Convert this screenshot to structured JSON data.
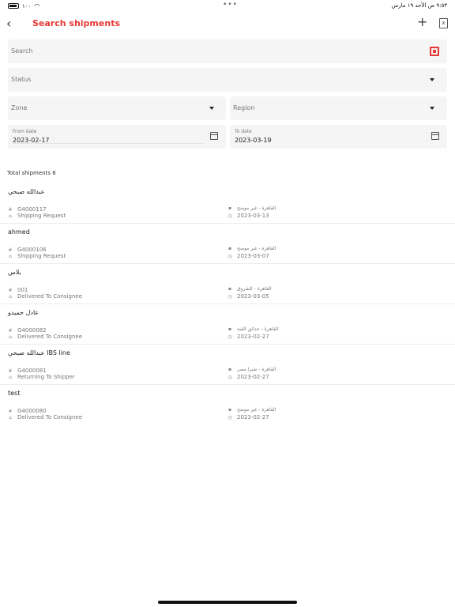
{
  "status_bar": {
    "time_date": "٩:٥٣ ص  الأحد ١٩ مارس",
    "dots": "•••",
    "battery": "١٠٠"
  },
  "header": {
    "title": "Search shipments",
    "back_icon": "chevron-left-icon",
    "add_icon": "plus-icon",
    "export_icon": "excel-file-icon"
  },
  "filters": {
    "search_placeholder": "Search",
    "status_placeholder": "Status",
    "zone_placeholder": "Zone",
    "region_placeholder": "Region",
    "from_label": "From date",
    "from_value": "2023-02-17",
    "to_label": "To date",
    "to_value": "2023-03-19"
  },
  "accent_color": "#e53935",
  "total_label": "Total shipments 6",
  "shipments": [
    {
      "name": "عبدالله صبحي",
      "code": "G4000117",
      "status": "Shipping Request",
      "location": "القاهرة - غير موضح",
      "date": "2023-03-13"
    },
    {
      "name": "ahmed",
      "code": "G4000106",
      "status": "Shipping Request",
      "location": "القاهرة - غير موضح",
      "date": "2023-03-07"
    },
    {
      "name": "بلاس",
      "code": "001",
      "status": "Delivered To Consignee",
      "location": "القاهرة - الشروق",
      "date": "2023-03-05"
    },
    {
      "name": "عادل حميدو",
      "code": "G4000082",
      "status": "Delivered To Consignee",
      "location": "القاهرة - حدائق القبة",
      "date": "2023-02-27"
    },
    {
      "name": "عبدالله صبحي IBS line",
      "code": "G4000081",
      "status": "Returning To Shipper",
      "location": "القاهرة - شبرا مصر",
      "date": "2023-02-27"
    },
    {
      "name": "test",
      "code": "G4000080",
      "status": "Delivered To Consignee",
      "location": "القاهرة - غير موضح",
      "date": "2023-02-27"
    }
  ]
}
